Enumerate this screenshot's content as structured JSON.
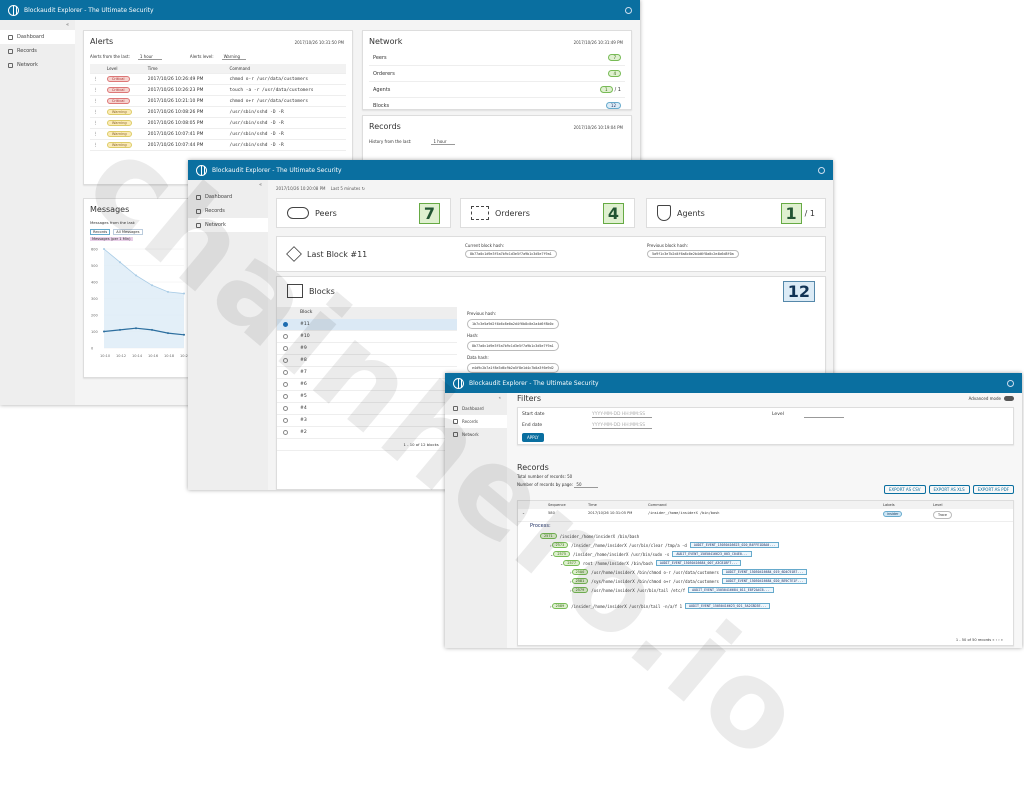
{
  "app": {
    "title": "Blockaudit Explorer - The Ultimate Security"
  },
  "sidebar": {
    "items": [
      {
        "label": "Dashboard"
      },
      {
        "label": "Records"
      },
      {
        "label": "Network"
      }
    ]
  },
  "alerts": {
    "title": "Alerts",
    "timestamp": "2017/10/26 10:31:50 PM",
    "from_label": "Alerts from the last:",
    "from_value": "1 hour",
    "level_label": "Alerts level:",
    "level_value": "Warning",
    "columns": [
      "Level",
      "Time",
      "Command"
    ],
    "rows": [
      {
        "level": "Critical",
        "time": "2017/10/26 10:26:49 PM",
        "command": "chmod o-r /usr/data/customers"
      },
      {
        "level": "Critical",
        "time": "2017/10/26 10:26:23 PM",
        "command": "touch -a -r /usr/data/customers"
      },
      {
        "level": "Critical",
        "time": "2017/10/26 10:21:10 PM",
        "command": "chmod o+r /usr/data/customers"
      },
      {
        "level": "Warning",
        "time": "2017/10/26 10:08:26 PM",
        "command": "/usr/sbin/sshd -D -R"
      },
      {
        "level": "Warning",
        "time": "2017/10/26 10:08:05 PM",
        "command": "/usr/sbin/sshd -D -R"
      },
      {
        "level": "Warning",
        "time": "2017/10/26 10:07:41 PM",
        "command": "/usr/sbin/sshd -D -R"
      },
      {
        "level": "Warning",
        "time": "2017/10/26 10:07:44 PM",
        "command": "/usr/sbin/sshd -D -R"
      }
    ]
  },
  "messages": {
    "title": "Messages",
    "from_label": "Messages from the last:",
    "from_value": "1 hour",
    "legend": [
      "Records",
      "All Messages",
      "Messages (per 1 Min)"
    ]
  },
  "network_card": {
    "title": "Network",
    "timestamp": "2017/10/26 10:31:49 PM",
    "rows": [
      {
        "label": "Peers",
        "value": "7"
      },
      {
        "label": "Orderers",
        "value": "4"
      },
      {
        "label": "Agents",
        "value": "1",
        "extra": "/ 1"
      },
      {
        "label": "Blocks",
        "value": "12"
      }
    ]
  },
  "records_card": {
    "title": "Records",
    "timestamp": "2017/10/26 10:19:04 PM",
    "from_label": "History from the last:",
    "from_value": "1 hour"
  },
  "network_view": {
    "timestamp": "2017/10/26 10:20:08 PM",
    "status": "Last 5 minutes",
    "peers": {
      "label": "Peers",
      "value": "7"
    },
    "orderers": {
      "label": "Orderers",
      "value": "4"
    },
    "agents": {
      "label": "Agents",
      "value": "1",
      "total": "/ 1"
    },
    "last_block": {
      "label": "Last Block #11",
      "current_label": "Current block hash:",
      "current_hash": "8b77a0c1d9e3f5a7b9c1d3e5f7a9b1c3d5e7f9a1",
      "previous_label": "Previous block hash:",
      "previous_hash": "5a9f1c3e7b2d4f6a8c0e2b4d6f8a0c2e4b6d8f0a"
    },
    "blocks": {
      "label": "Blocks",
      "count": "12",
      "column": "Block",
      "items": [
        "#11",
        "#10",
        "#9",
        "#8",
        "#7",
        "#6",
        "#5",
        "#4",
        "#3",
        "#2"
      ],
      "footer": "1 - 10 of 12 blocks",
      "previous_label": "Previous hash:",
      "previous_hash": "1b7c3e5a9d2f4b6c8e0a2d4f6b8c0e2a4d6f8b0c",
      "hash_label": "Hash:",
      "hash": "8b77a0c1d9e3f5a7b9c1d3e5f7a9b1c3d5e7f9a1",
      "data_label": "Data hash:",
      "data_hash": "e4d9c2b7a1f8e3d6c9b2a5f8e1d4c7b0a3f6e9d2"
    }
  },
  "records_view": {
    "filters_title": "Filters",
    "advanced_label": "Advanced mode",
    "start_label": "Start date",
    "start_placeholder": "YYYY-MM-DD HH:MM:SS",
    "end_label": "End date",
    "end_placeholder": "YYYY-MM-DD HH:MM:SS",
    "level_label": "Level",
    "apply": "APPLY",
    "records_title": "Records",
    "total": "Total number of records: 50",
    "per_page_label": "Number of records by page:",
    "per_page": "50",
    "export_csv": "EXPORT AS CSV",
    "export_xls": "EXPORT AS XLS",
    "export_pdf": "EXPORT AS PDF",
    "columns": [
      "Sequence",
      "Time",
      "Command",
      "Labels",
      "Level"
    ],
    "row": {
      "sequence": "580",
      "time": "2017/10/26 10:31:05 PM",
      "command": "/insider_/home/insiderX /bin/bash",
      "label": "insider",
      "level": "Trace"
    },
    "process_label": "Process:",
    "process": [
      {
        "pid": "2571",
        "cmd": "/insider_/home/insiderX /bin/bash",
        "event": ""
      },
      {
        "pid": "2573",
        "cmd": "/insider_/home/insiderX /usr/bin/clear /tmp/a -d",
        "event": "AUDIT_EVENT_15050416623_020_B4FFE1D8A0..."
      },
      {
        "pid": "2575",
        "cmd": "/insider_/home/insiderX /usr/bin/sudo -s",
        "event": "AUDIT_EVENT_15050416623_003_C04E0..."
      },
      {
        "pid": "2577",
        "cmd": "root /home/insiderX /bin/bash",
        "event": "AUDIT_EVENT_15050416684_007_A3C81BF7..."
      },
      {
        "pid": "2580",
        "cmd": "/usr/home/insiderX /bin/chmod o-r /usr/data/customers",
        "event": "AUDIT_EVENT_15050416684_019_6D4C91B7..."
      },
      {
        "pid": "2581",
        "cmd": "/sys/home/insiderX /bin/chmod o+r /usr/data/customers",
        "event": "AUDIT_EVENT_15050416684_020_BE9C7E1F..."
      },
      {
        "pid": "2579",
        "cmd": "/usr/home/insiderX /usr/bin/tail /etc/f",
        "event": "AUDIT_EVENT_15050416684_011_E8F2A4C6..."
      },
      {
        "pid": "2589",
        "cmd": "/insider_/home/insiderX /usr/bin/tail -n/a/f 1",
        "event": "AUDIT_EVENT_15050416623_021_5A2C8D3E..."
      }
    ],
    "footer": "1 - 50 of 50 records"
  },
  "colors": {
    "header": "#0a6fa0",
    "critical": "#f6d3cf",
    "warning": "#fbeab5",
    "ok": "#dff0d0"
  },
  "chart_data": {
    "type": "line",
    "x": [
      "10:10",
      "10:12",
      "10:14",
      "10:16",
      "10:18",
      "10:20"
    ],
    "series": [
      {
        "name": "All Messages",
        "values": [
          600,
          520,
          440,
          380,
          340,
          330
        ]
      },
      {
        "name": "Records",
        "values": [
          100,
          110,
          120,
          110,
          90,
          80
        ]
      }
    ],
    "ylim": [
      0,
      600
    ]
  },
  "watermark": "chainhero.io"
}
